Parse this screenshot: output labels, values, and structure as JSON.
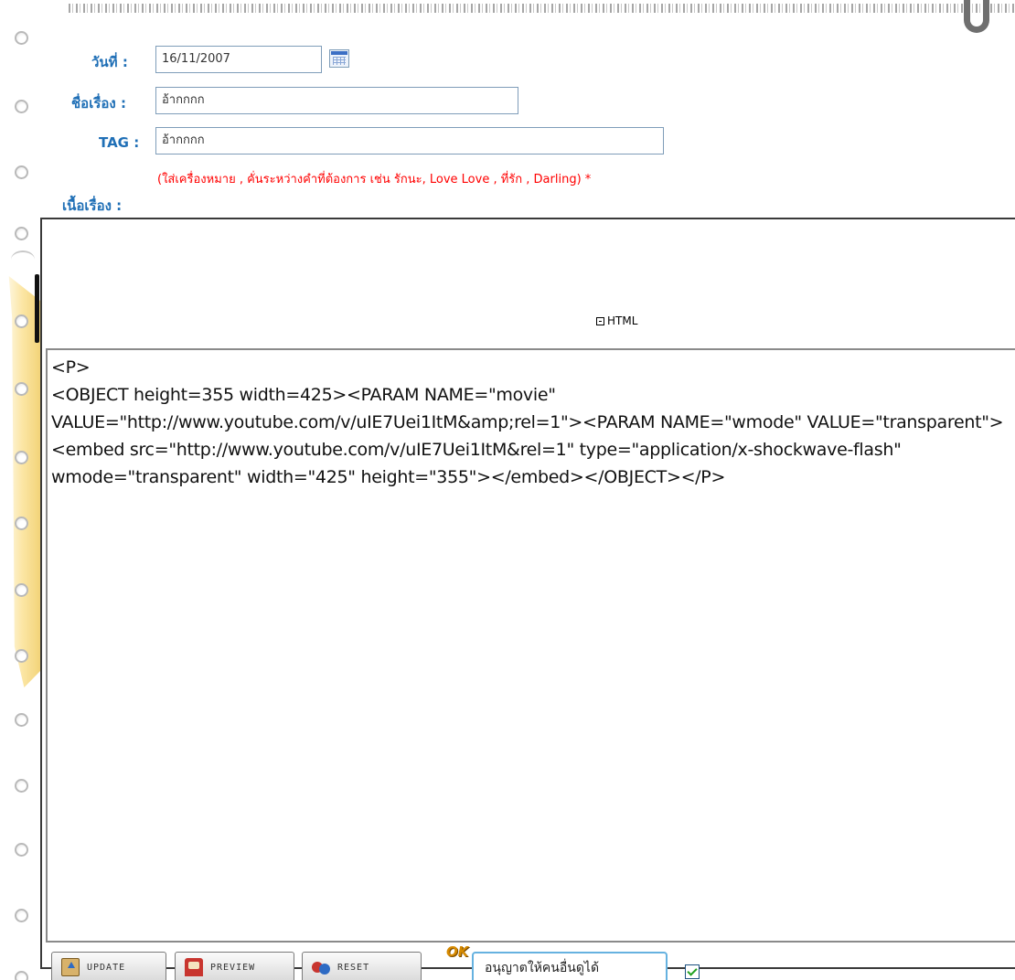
{
  "form": {
    "date": {
      "label": "วันที่",
      "colon": ":",
      "value": "16/11/2007"
    },
    "title": {
      "label": "ชื่อเรื่อง",
      "colon": ":",
      "value": "อ้ากกกก"
    },
    "tag": {
      "label": "TAG",
      "colon": ":",
      "value": "อ้ากกกก"
    },
    "tag_hint": "(ใส่เครื่องหมาย , คั่นระหว่างคำที่ต้องการ เช่น รักนะ, Love Love , ที่รัก , Darling) *",
    "content": {
      "label": "เนื้อเรื่อง",
      "colon": ":"
    }
  },
  "editor": {
    "html_toggle_label": "HTML",
    "source": "<P>\n<OBJECT height=355 width=425><PARAM NAME=\"movie\" VALUE=\"http://www.youtube.com/v/uIE7Uei1ItM&amp;rel=1\"><PARAM NAME=\"wmode\" VALUE=\"transparent\">\n<embed src=\"http://www.youtube.com/v/uIE7Uei1ItM&rel=1\" type=\"application/x-shockwave-flash\" wmode=\"transparent\" width=\"425\" height=\"355\"></embed></OBJECT></P>"
  },
  "toolbar": {
    "update_label": "UPDATE",
    "preview_label": "PREVIEW",
    "reset_label": "RESET",
    "ok_mark": "OK",
    "allow_comments_label": "อนุญาตให้คนอื่นดูได้",
    "allow_checked": true
  },
  "colors": {
    "label_blue": "#1f6fb6",
    "hint_red": "#ff0000",
    "field_border": "#7f9db9"
  },
  "icons": [
    "calendar-icon",
    "html-toggle-icon",
    "update-icon",
    "preview-icon",
    "reset-icon",
    "check-icon"
  ]
}
